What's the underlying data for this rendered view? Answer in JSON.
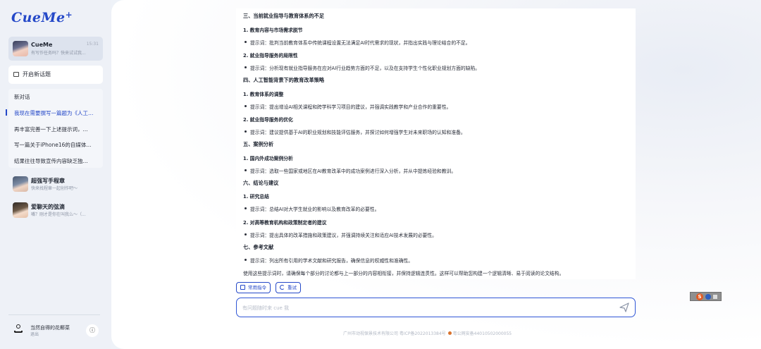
{
  "app": {
    "logo": "CueMe",
    "logo_mark": "+"
  },
  "sidebar": {
    "chat_card": {
      "name": "CueMe",
      "time": "15:31",
      "preview": "有写作任务吗？快来试试我..."
    },
    "new_chat_label": "开启新话题",
    "topics": [
      "新对话",
      "我现在需要撰写一篇题为《人工智能...",
      "再丰富完善一下上述提示词，...",
      "写一篇关于iPhone16的自媒体...",
      "结果往往导致宣传内容缺乏独..."
    ],
    "active_topic_index": 1,
    "contacts": [
      {
        "name": "超强写手程章",
        "preview": "快来找程章一起创作吧～"
      },
      {
        "name": "爱聊天的弦滴",
        "preview": "嘴？刚才是你在叫我么～（..."
      }
    ],
    "user": {
      "name": "当然自得的花椰菜",
      "logout": "退出",
      "info_icon": "info-icon"
    }
  },
  "main": {
    "lines": [
      {
        "type": "h2",
        "text": "三、当前就业指导与教育体系的不足"
      },
      {
        "type": "h3",
        "text": "1. 教育内容与市场需求脱节"
      },
      {
        "type": "bullet",
        "text": "提示词：批判当前教育体系中传统课程设置无法满足AI时代需求的现状，并指出实践与理论结合的不足。"
      },
      {
        "type": "h3",
        "text": "2. 就业指导服务的局限性"
      },
      {
        "type": "bullet",
        "text": "提示词：分析现有就业指导服务在应对AI行业趋势方面的不足，以及在支持学生个性化职业规划方面的缺陷。"
      },
      {
        "type": "h2",
        "text": "四、人工智能背景下的教育改革策略"
      },
      {
        "type": "h3",
        "text": "1. 教育体系的调整"
      },
      {
        "type": "bullet",
        "text": "提示词：提出增设AI相关课程和跨学科学习项目的建议，并强调实践教学和产业合作的重要性。"
      },
      {
        "type": "h3",
        "text": "2. 就业指导服务的优化"
      },
      {
        "type": "bullet",
        "text": "提示词：建议提供基于AI的职业规划和技能评估服务，并探讨如何增强学生对未来职场的认知和准备。"
      },
      {
        "type": "h2",
        "text": "五、案例分析"
      },
      {
        "type": "h3",
        "text": "1. 国内外成功案例分析"
      },
      {
        "type": "bullet",
        "text": "提示词：选取一些国家或地区在AI教育改革中的成功案例进行深入分析，并从中提炼经验和教训。"
      },
      {
        "type": "h2",
        "text": "六、结论与建议"
      },
      {
        "type": "h3",
        "text": "1. 研究总结"
      },
      {
        "type": "bullet",
        "text": "提示词：总结AI对大学生就业的影响以及教育改革的必要性。"
      },
      {
        "type": "h3",
        "text": "2. 对高等教育机构和政策制定者的建议"
      },
      {
        "type": "bullet",
        "text": "提示词：提出具体的改革措施和政策建议，并强调持续关注和适应AI技术发展的必要性。"
      },
      {
        "type": "h2",
        "text": "七、参考文献"
      },
      {
        "type": "bullet",
        "text": "提示词：列出所有引用的学术文献和研究报告，确保信息的权威性和准确性。"
      },
      {
        "type": "p",
        "text": "使用这些提示词时，请确保每个部分的讨论都与上一部分的内容相衔接，并保持逻辑连贯性。这样可以帮助您构建一个逻辑清晰、易于阅读的论文结构。"
      }
    ],
    "buttons": {
      "commands": "常用指令",
      "retry": "重试"
    },
    "input_placeholder": "有问题随时来 cue 我",
    "footer": {
      "company": "广州市动视保景技术有限公司 粤ICP备2022013384号",
      "police": "粤公网安备44010502000055"
    }
  },
  "colors": {
    "accent": "#2448c8",
    "input_border": "#2f56d6"
  }
}
